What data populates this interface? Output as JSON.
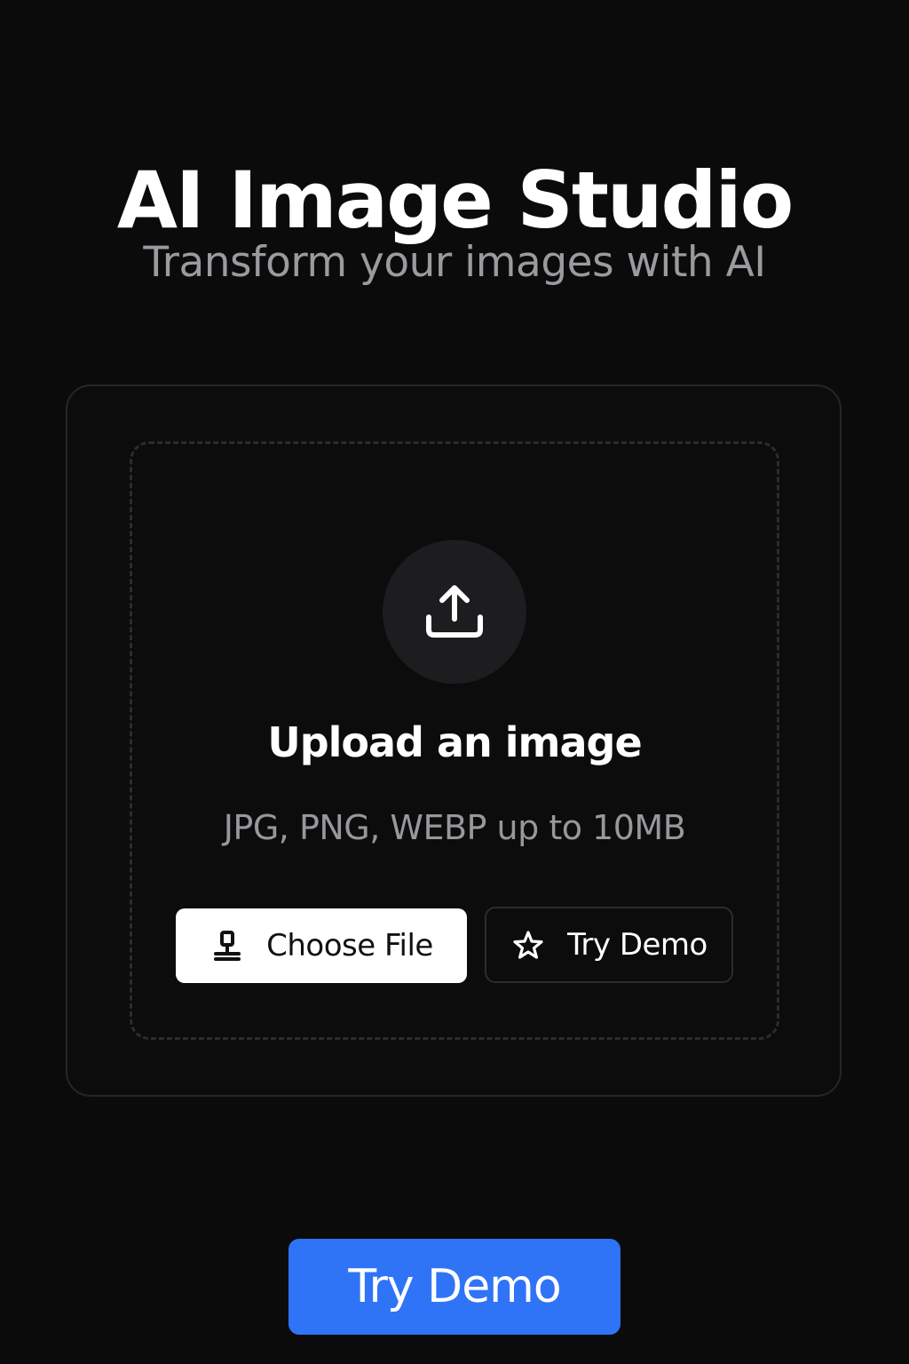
{
  "header": {
    "title": "AI Image Studio",
    "subtitle": "Transform your images with AI"
  },
  "upload": {
    "icon": "upload-icon",
    "heading": "Upload an image",
    "hint": "JPG, PNG, WEBP up to 10MB",
    "choose_file": {
      "label": "Choose File",
      "icon": "upload-stamp-icon"
    },
    "try_demo": {
      "label": "Try Demo",
      "icon": "star-icon"
    }
  },
  "footer": {
    "try_demo_label": "Try Demo"
  },
  "colors": {
    "background": "#0b0b0c",
    "accent": "#2f74f7",
    "muted_text": "#9a9a9f"
  }
}
